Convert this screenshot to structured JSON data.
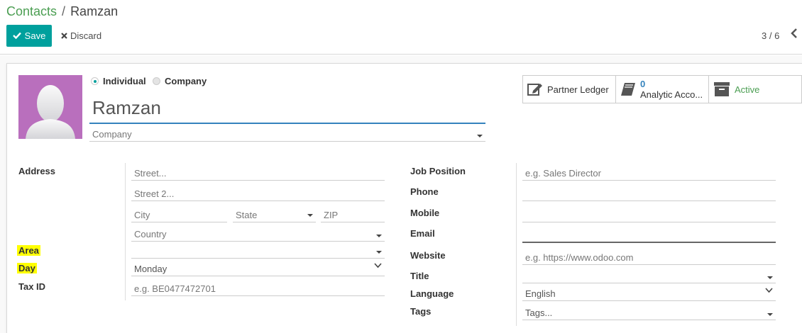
{
  "breadcrumb": {
    "parent": "Contacts",
    "separator": "/",
    "current": "Ramzan"
  },
  "toolbar": {
    "save_label": "Save",
    "discard_label": "Discard"
  },
  "pager": {
    "value": "3 / 6"
  },
  "partner_type": {
    "individual": "Individual",
    "company": "Company",
    "selected": "Individual"
  },
  "name": {
    "value": "Ramzan"
  },
  "company_field": {
    "placeholder": "Company"
  },
  "smart_buttons": {
    "ledger": "Partner Ledger",
    "analytic_count": "0",
    "analytic_label": "Analytic Acco...",
    "active": "Active"
  },
  "address": {
    "label": "Address",
    "street_placeholder": "Street...",
    "street2_placeholder": "Street 2...",
    "city_placeholder": "City",
    "state_placeholder": "State",
    "zip_placeholder": "ZIP",
    "country_placeholder": "Country"
  },
  "area": {
    "label": "Area",
    "value": ""
  },
  "day": {
    "label": "Day",
    "value": "Monday"
  },
  "tax_id": {
    "label": "Tax ID",
    "placeholder": "e.g. BE0477472701"
  },
  "job_position": {
    "label": "Job Position",
    "placeholder": "e.g. Sales Director"
  },
  "phone": {
    "label": "Phone",
    "value": ""
  },
  "mobile": {
    "label": "Mobile",
    "value": ""
  },
  "email": {
    "label": "Email",
    "value": ""
  },
  "website": {
    "label": "Website",
    "placeholder": "e.g. https://www.odoo.com"
  },
  "title": {
    "label": "Title",
    "value": ""
  },
  "language": {
    "label": "Language",
    "value": "English"
  },
  "tags": {
    "label": "Tags",
    "placeholder": "Tags..."
  },
  "colors": {
    "accent": "#00a09d",
    "link": "#4b9e52",
    "highlight": "#ffff00",
    "avatar_bg": "#b96fbd",
    "focus": "#3583bd"
  }
}
